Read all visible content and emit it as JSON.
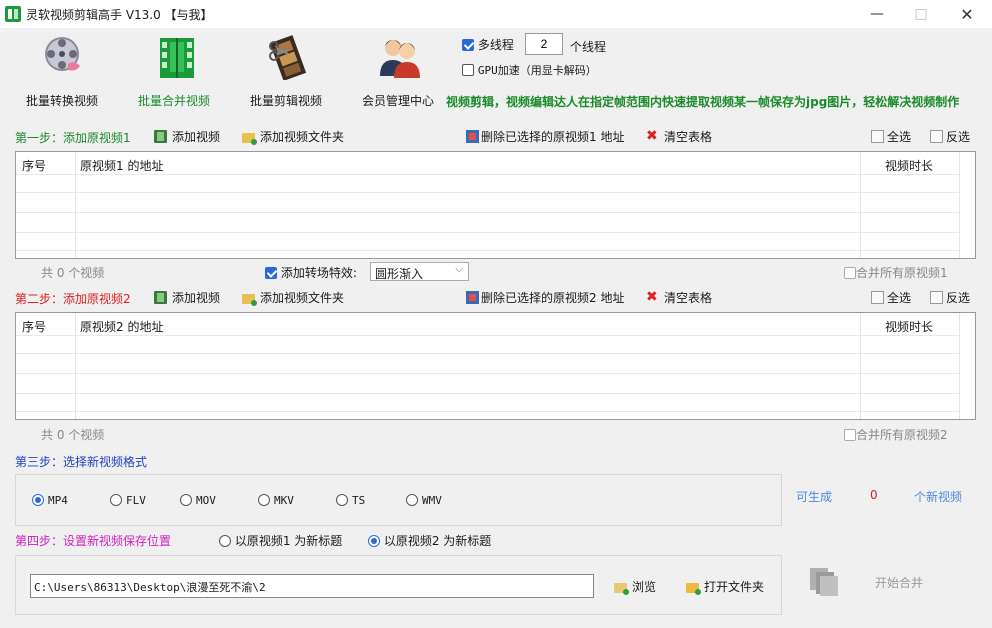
{
  "window": {
    "title": "灵软视频剪辑高手 V13.0 【与我】",
    "minimize": "—",
    "maximize": "□",
    "close": "✕"
  },
  "toolbar": {
    "convert": "批量转换视频",
    "merge": "批量合并视频",
    "cut": "批量剪辑视频",
    "member": "会员管理中心"
  },
  "options": {
    "multithread_label": "多线程",
    "thread_count": "2",
    "thread_unit": "个线程",
    "gpu_label": "GPU加速（用显卡解码）",
    "multithread_checked": true,
    "gpu_checked": false
  },
  "promo": "视频剪辑，视频编辑达人在指定帧范围内快速提取视频某一帧保存为jpg图片，轻松解决视频制作",
  "step1": {
    "label": "第一步：添加原视频1",
    "add_video": "添加视频",
    "add_folder": "添加视频文件夹",
    "delete_selected": "删除已选择的原视频1 地址",
    "clear_table": "清空表格",
    "select_all": "全选",
    "invert": "反选",
    "columns": [
      "序号",
      "原视频1 的地址",
      "视频时长"
    ],
    "count_text": "共 0 个视频",
    "transition_label": "添加转场特效:",
    "transition_checked": true,
    "transition_value": "圆形渐入",
    "merge_all": "合并所有原视频1"
  },
  "step2": {
    "label": "第二步：添加原视频2",
    "add_video": "添加视频",
    "add_folder": "添加视频文件夹",
    "delete_selected": "删除已选择的原视频2 地址",
    "clear_table": "清空表格",
    "select_all": "全选",
    "invert": "反选",
    "columns": [
      "序号",
      "原视频2 的地址",
      "视频时长"
    ],
    "count_text": "共 0 个视频",
    "merge_all": "合并所有原视频2"
  },
  "step3": {
    "label": "第三步：选择新视频格式",
    "formats": [
      "MP4",
      "FLV",
      "MOV",
      "MKV",
      "TS",
      "WMV"
    ],
    "selected_format": "MP4",
    "gen_label": "可生成",
    "gen_count": "0",
    "gen_unit": "个新视频"
  },
  "step4": {
    "label": "第四步：设置新视频保存位置",
    "title_option_1": "以原视频1 为新标题",
    "title_option_2": "以原视频2 为新标题",
    "selected_title_option": 2,
    "save_path": "C:\\Users\\86313\\Desktop\\浪漫至死不渝\\2",
    "browse": "浏览",
    "open_folder": "打开文件夹",
    "start_merge": "开始合并"
  },
  "colors": {
    "step1": "#1a8a2a",
    "step2": "#e02020",
    "step3": "#2040c0",
    "step4": "#d020c0",
    "promo": "#1a8a2a",
    "accent": "#2a6ad8"
  }
}
